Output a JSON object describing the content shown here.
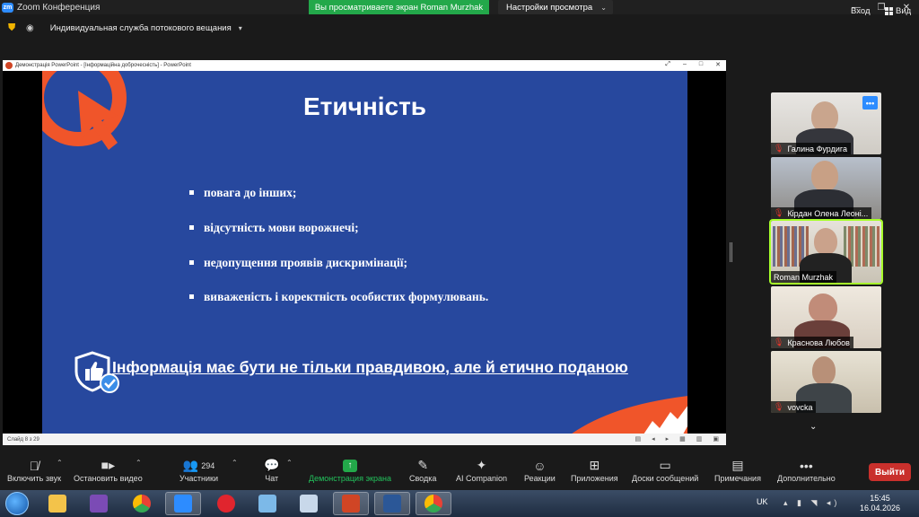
{
  "window": {
    "app_title": "Zoom Конференция",
    "logo_text": "zm"
  },
  "banner": {
    "sharing_text": "Вы просматриваете экран Roman Murzhak",
    "view_options": "Настройки просмотра"
  },
  "toolbar2": {
    "stream_label": "Индивидуальная служба потокового вещания",
    "exit_label": "Вход",
    "view_label": "Вид"
  },
  "ppt": {
    "window_title": "Демонстрація PowerPoint - [Інформаційна доброчесність] - PowerPoint",
    "status_left": "Слайд 8 з 29",
    "slide": {
      "title": "Етичність",
      "bullets": [
        "повага до інших;",
        "відсутність мови ворожнечі;",
        "недопущення проявів дискримінації;",
        "виваженість і коректність особистих формулювань."
      ],
      "tagline": "Інформація має бути не тільки правдивою, але й етично поданою"
    },
    "colors": {
      "slide_bg": "#27489e",
      "accent": "#f0552a"
    }
  },
  "participants": [
    {
      "name": "Галина Фурдига",
      "muted": true
    },
    {
      "name": "Кірдан Олена Леоні...",
      "muted": true
    },
    {
      "name": "Roman Murzhak",
      "muted": false,
      "active_speaker": true
    },
    {
      "name": "Краснова Любов",
      "muted": true
    },
    {
      "name": "vovcka",
      "muted": true
    }
  ],
  "more_icon": "•••",
  "controls": {
    "mute": "Включить звук",
    "video": "Остановить видео",
    "participants": "Участники",
    "participants_count": "294",
    "chat": "Чат",
    "share": "Демонстрация экрана",
    "summary": "Сводка",
    "ai": "AI Companion",
    "reactions": "Реакции",
    "apps": "Приложения",
    "whiteboards": "Доски сообщений",
    "notes": "Примечания",
    "more": "Дополнительно",
    "leave": "Выйти"
  },
  "taskbar": {
    "language": "UK",
    "time": "15:45",
    "date": "16.04.2026"
  }
}
